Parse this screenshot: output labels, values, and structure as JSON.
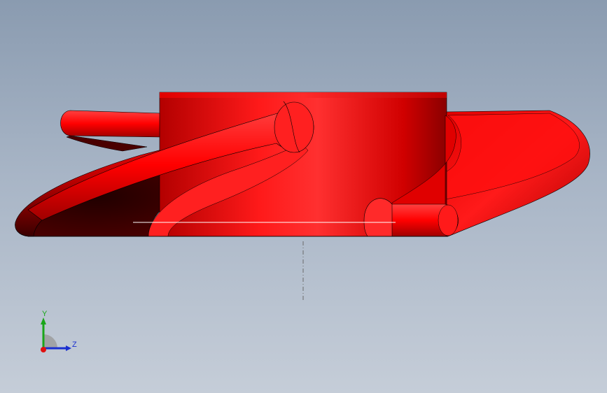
{
  "viewport": {
    "model_color": "#ff0000",
    "background_top": "#8a9bb0",
    "background_bottom": "#c5cdd8"
  },
  "triad": {
    "y_label": "Y",
    "z_label": "Z",
    "y_color": "#1aa61a",
    "z_color": "#1a2fd0",
    "x_color": "#e01010"
  }
}
